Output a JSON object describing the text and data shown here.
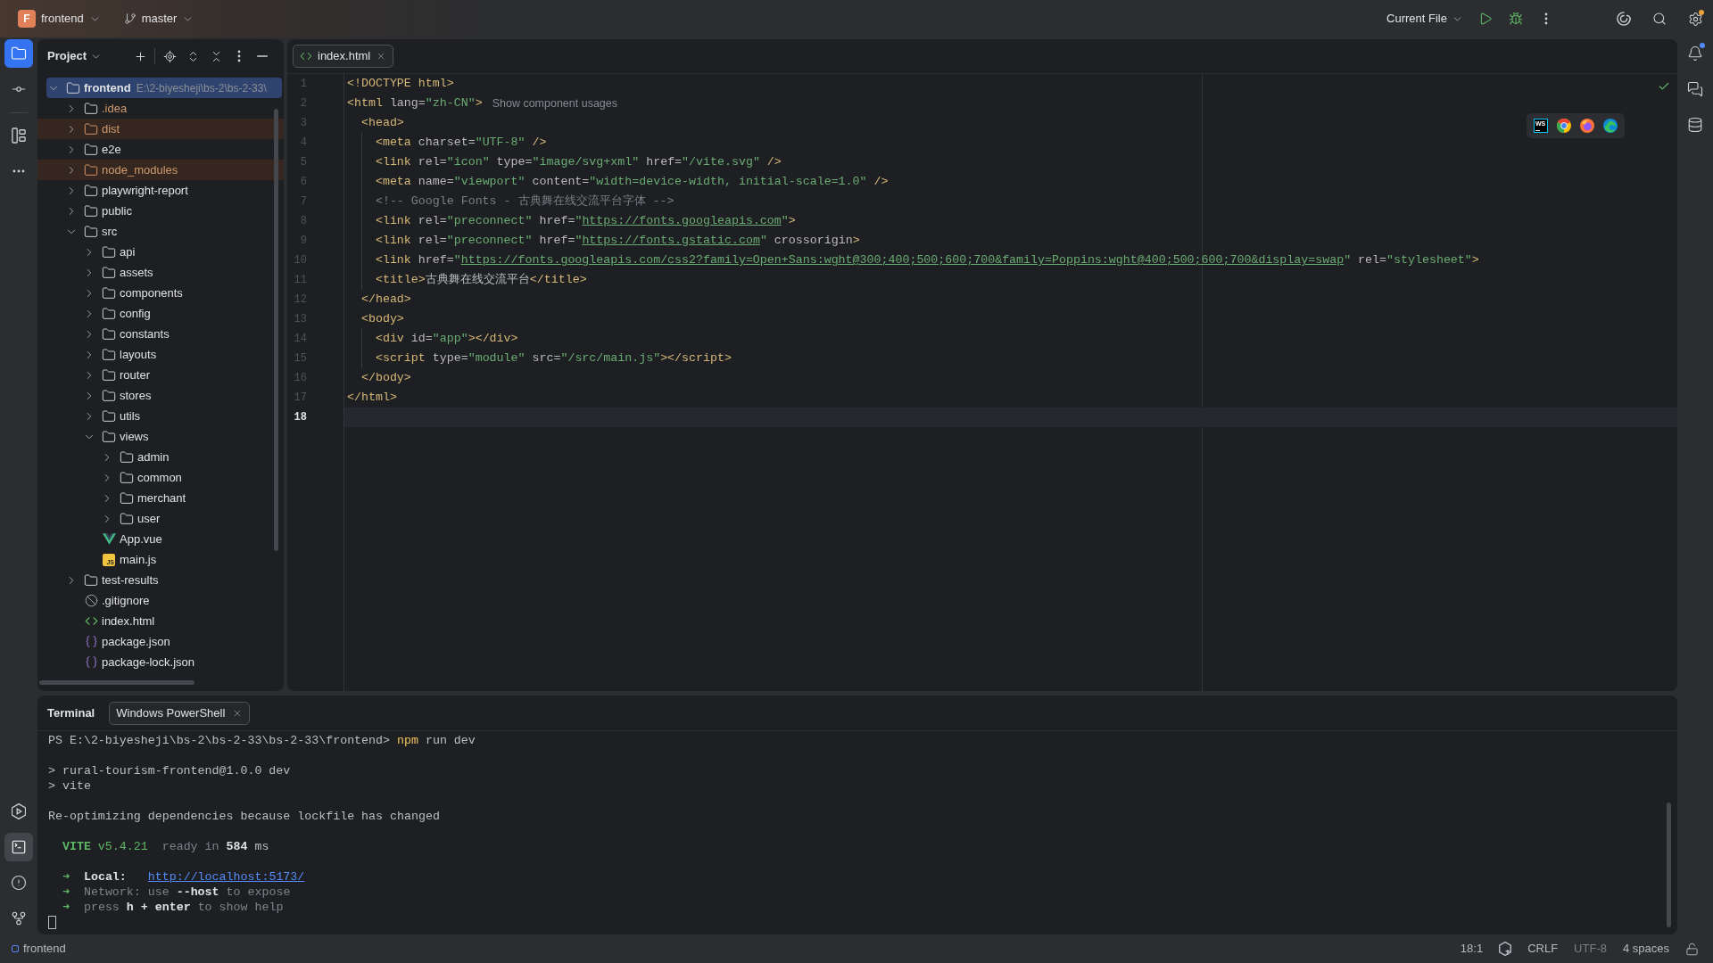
{
  "title_bar": {
    "project": {
      "initial": "F",
      "name": "frontend"
    },
    "branch": "master",
    "run_configuration": "Current File",
    "settings_badge": true
  },
  "left_toolbar": {
    "top_buttons": [
      {
        "selected": true
      },
      {
        "selected": false
      },
      {
        "selected": false
      },
      {
        "selected": false
      }
    ],
    "bottom_buttons": [
      {
        "selected": false
      },
      {
        "selected": true
      },
      {
        "selected": false
      },
      {
        "selected": false
      }
    ]
  },
  "project_panel": {
    "title": "Project",
    "tree": [
      {
        "name": "frontend",
        "path": "E:\\2-biyesheji\\bs-2\\bs-2-33\\",
        "kind": "folder",
        "expanded": true,
        "selected": true,
        "ignored": false,
        "excluded": false,
        "children": [
          {
            "name": ".idea",
            "kind": "folder",
            "expanded": false,
            "selected": false,
            "ignored": true,
            "excluded": false
          },
          {
            "name": "dist",
            "kind": "folder",
            "expanded": false,
            "selected": false,
            "ignored": true,
            "excluded": true
          },
          {
            "name": "e2e",
            "kind": "folder",
            "expanded": false,
            "selected": false,
            "ignored": false,
            "excluded": false
          },
          {
            "name": "node_modules",
            "kind": "folder",
            "expanded": false,
            "selected": false,
            "ignored": true,
            "excluded": true
          },
          {
            "name": "playwright-report",
            "kind": "folder",
            "expanded": false,
            "selected": false,
            "ignored": false,
            "excluded": false
          },
          {
            "name": "public",
            "kind": "folder",
            "expanded": false,
            "selected": false,
            "ignored": false,
            "excluded": false
          },
          {
            "name": "src",
            "kind": "folder",
            "expanded": true,
            "selected": false,
            "ignored": false,
            "excluded": false,
            "children": [
              {
                "name": "api",
                "kind": "folder",
                "expanded": false,
                "selected": false,
                "ignored": false,
                "excluded": false
              },
              {
                "name": "assets",
                "kind": "folder",
                "expanded": false,
                "selected": false,
                "ignored": false,
                "excluded": false
              },
              {
                "name": "components",
                "kind": "folder",
                "expanded": false,
                "selected": false,
                "ignored": false,
                "excluded": false
              },
              {
                "name": "config",
                "kind": "folder",
                "expanded": false,
                "selected": false,
                "ignored": false,
                "excluded": false
              },
              {
                "name": "constants",
                "kind": "folder",
                "expanded": false,
                "selected": false,
                "ignored": false,
                "excluded": false
              },
              {
                "name": "layouts",
                "kind": "folder",
                "expanded": false,
                "selected": false,
                "ignored": false,
                "excluded": false
              },
              {
                "name": "router",
                "kind": "folder",
                "expanded": false,
                "selected": false,
                "ignored": false,
                "excluded": false
              },
              {
                "name": "stores",
                "kind": "folder",
                "expanded": false,
                "selected": false,
                "ignored": false,
                "excluded": false
              },
              {
                "name": "utils",
                "kind": "folder",
                "expanded": false,
                "selected": false,
                "ignored": false,
                "excluded": false
              },
              {
                "name": "views",
                "kind": "folder",
                "expanded": true,
                "selected": false,
                "ignored": false,
                "excluded": false,
                "children": [
                  {
                    "name": "admin",
                    "kind": "folder",
                    "expanded": false,
                    "selected": false,
                    "ignored": false,
                    "excluded": false
                  },
                  {
                    "name": "common",
                    "kind": "folder",
                    "expanded": false,
                    "selected": false,
                    "ignored": false,
                    "excluded": false
                  },
                  {
                    "name": "merchant",
                    "kind": "folder",
                    "expanded": false,
                    "selected": false,
                    "ignored": false,
                    "excluded": false
                  },
                  {
                    "name": "user",
                    "kind": "folder",
                    "expanded": false,
                    "selected": false,
                    "ignored": false,
                    "excluded": false
                  }
                ]
              },
              {
                "name": "App.vue",
                "kind": "vue",
                "selected": false,
                "ignored": false,
                "excluded": false
              },
              {
                "name": "main.js",
                "kind": "js",
                "icon_text": "JS",
                "selected": false,
                "ignored": false,
                "excluded": false
              }
            ]
          },
          {
            "name": "test-results",
            "kind": "folder",
            "expanded": false,
            "selected": false,
            "ignored": false,
            "excluded": false
          },
          {
            "name": ".gitignore",
            "kind": "gitignore",
            "selected": false,
            "ignored": false,
            "excluded": false
          },
          {
            "name": "index.html",
            "kind": "html",
            "selected": false,
            "ignored": false,
            "excluded": false
          },
          {
            "name": "package.json",
            "kind": "json",
            "selected": false,
            "ignored": false,
            "excluded": false
          },
          {
            "name": "package-lock.json",
            "kind": "json",
            "selected": false,
            "ignored": false,
            "excluded": false
          }
        ]
      }
    ]
  },
  "editor": {
    "tabs": [
      {
        "name": "index.html",
        "selected": true
      }
    ],
    "lines": [
      {
        "number": "1",
        "current": false,
        "tokens": [
          {
            "text": "<!DOCTYPE html>",
            "kind": "tag"
          }
        ]
      },
      {
        "number": "2",
        "current": false,
        "tokens": [
          {
            "text": "<html",
            "kind": "tag"
          },
          {
            "text": " lang=",
            "kind": "attr"
          },
          {
            "text": "\"zh-CN\"",
            "kind": "value"
          },
          {
            "text": ">",
            "kind": "tag"
          }
        ],
        "hint": "Show component usages"
      },
      {
        "number": "3",
        "current": false,
        "tokens": [
          {
            "text": "  <head>",
            "kind": "tag"
          }
        ]
      },
      {
        "number": "4",
        "current": false,
        "tokens": [
          {
            "text": "    <meta",
            "kind": "tag"
          },
          {
            "text": " charset=",
            "kind": "attr"
          },
          {
            "text": "\"UTF-8\"",
            "kind": "value"
          },
          {
            "text": " />",
            "kind": "tag"
          }
        ]
      },
      {
        "number": "5",
        "current": false,
        "tokens": [
          {
            "text": "    <link",
            "kind": "tag"
          },
          {
            "text": " rel=",
            "kind": "attr"
          },
          {
            "text": "\"icon\"",
            "kind": "value"
          },
          {
            "text": " type=",
            "kind": "attr"
          },
          {
            "text": "\"image/svg+xml\"",
            "kind": "value"
          },
          {
            "text": " href=",
            "kind": "attr"
          },
          {
            "text": "\"/vite.svg\"",
            "kind": "value"
          },
          {
            "text": " />",
            "kind": "tag"
          }
        ]
      },
      {
        "number": "6",
        "current": false,
        "tokens": [
          {
            "text": "    <meta",
            "kind": "tag"
          },
          {
            "text": " name=",
            "kind": "attr"
          },
          {
            "text": "\"viewport\"",
            "kind": "value"
          },
          {
            "text": " content=",
            "kind": "attr"
          },
          {
            "text": "\"width=device-width, initial-scale=1.0\"",
            "kind": "value"
          },
          {
            "text": " />",
            "kind": "tag"
          }
        ]
      },
      {
        "number": "7",
        "current": false,
        "tokens": [
          {
            "text": "    <!-- Google Fonts - 古典舞在线交流平台字体 -->",
            "kind": "comment"
          }
        ]
      },
      {
        "number": "8",
        "current": false,
        "tokens": [
          {
            "text": "    <link",
            "kind": "tag"
          },
          {
            "text": " rel=",
            "kind": "attr"
          },
          {
            "text": "\"preconnect\"",
            "kind": "value"
          },
          {
            "text": " href=",
            "kind": "attr"
          },
          {
            "text": "\"",
            "kind": "value"
          },
          {
            "text": "https://fonts.googleapis.com",
            "kind": "url"
          },
          {
            "text": "\"",
            "kind": "value"
          },
          {
            "text": ">",
            "kind": "tag"
          }
        ]
      },
      {
        "number": "9",
        "current": false,
        "tokens": [
          {
            "text": "    <link",
            "kind": "tag"
          },
          {
            "text": " rel=",
            "kind": "attr"
          },
          {
            "text": "\"preconnect\"",
            "kind": "value"
          },
          {
            "text": " href=",
            "kind": "attr"
          },
          {
            "text": "\"",
            "kind": "value"
          },
          {
            "text": "https://fonts.gstatic.com",
            "kind": "url"
          },
          {
            "text": "\"",
            "kind": "value"
          },
          {
            "text": " crossorigin",
            "kind": "attr"
          },
          {
            "text": ">",
            "kind": "tag"
          }
        ]
      },
      {
        "number": "10",
        "current": false,
        "tokens": [
          {
            "text": "    <link",
            "kind": "tag"
          },
          {
            "text": " href=",
            "kind": "attr"
          },
          {
            "text": "\"",
            "kind": "value"
          },
          {
            "text": "https://fonts.googleapis.com/css2?family=Open+Sans:wght@300;400;500;600;700&family=Poppins:wght@400;500;600;700&display=swap",
            "kind": "url"
          },
          {
            "text": "\"",
            "kind": "value"
          },
          {
            "text": " rel=",
            "kind": "attr"
          },
          {
            "text": "\"stylesheet\"",
            "kind": "value"
          },
          {
            "text": ">",
            "kind": "tag"
          }
        ]
      },
      {
        "number": "11",
        "current": false,
        "tokens": [
          {
            "text": "    <title>",
            "kind": "tag"
          },
          {
            "text": "古典舞在线交流平台",
            "kind": "text"
          },
          {
            "text": "</title>",
            "kind": "tag"
          }
        ]
      },
      {
        "number": "12",
        "current": false,
        "tokens": [
          {
            "text": "  </head>",
            "kind": "tag"
          }
        ]
      },
      {
        "number": "13",
        "current": false,
        "tokens": [
          {
            "text": "  <body>",
            "kind": "tag"
          }
        ]
      },
      {
        "number": "14",
        "current": false,
        "tokens": [
          {
            "text": "    <div",
            "kind": "tag"
          },
          {
            "text": " id=",
            "kind": "attr"
          },
          {
            "text": "\"app\"",
            "kind": "value"
          },
          {
            "text": "></div>",
            "kind": "tag"
          }
        ]
      },
      {
        "number": "15",
        "current": false,
        "tokens": [
          {
            "text": "    <script",
            "kind": "tag"
          },
          {
            "text": " type=",
            "kind": "attr"
          },
          {
            "text": "\"module\"",
            "kind": "value"
          },
          {
            "text": " src=",
            "kind": "attr"
          },
          {
            "text": "\"/src/main.js\"",
            "kind": "value"
          },
          {
            "text": "></script>",
            "kind": "tag"
          }
        ]
      },
      {
        "number": "16",
        "current": false,
        "tokens": [
          {
            "text": "  </body>",
            "kind": "tag"
          }
        ]
      },
      {
        "number": "17",
        "current": false,
        "tokens": [
          {
            "text": "</html>",
            "kind": "tag"
          }
        ]
      },
      {
        "number": "18",
        "current": true
      }
    ],
    "browser_popup": {
      "ide_logo": "WS"
    }
  },
  "right_toolbar": [
    {
      "badge": true
    },
    {
      "badge": false
    },
    {
      "badge": false
    }
  ],
  "terminal": {
    "title": "Terminal",
    "tabs": [
      {
        "name": "Windows PowerShell",
        "selected": true
      }
    ],
    "blocks": [
      {
        "lines": [
          {
            "tokens": [
              {
                "text": "PS E:\\2-biyesheji\\bs-2\\bs-2-33\\bs-2-33\\frontend> ",
                "kind": "plain"
              },
              {
                "text": "npm",
                "kind": "command"
              },
              {
                "text": " run dev",
                "kind": "plain"
              }
            ]
          }
        ]
      },
      {
        "lines": [
          {
            "tokens": [
              {
                "text": "> rural-tourism-frontend@1.0.0 dev",
                "kind": "plain"
              }
            ]
          },
          {
            "tokens": [
              {
                "text": "> vite",
                "kind": "plain"
              }
            ]
          }
        ]
      },
      {
        "lines": [
          {
            "tokens": [
              {
                "text": "Re-optimizing dependencies because lockfile has changed",
                "kind": "plain"
              }
            ]
          }
        ]
      },
      {
        "lines": [
          {
            "tokens": [
              {
                "text": "  VITE",
                "kind": "accent-bold"
              },
              {
                "text": " v5.4.21",
                "kind": "accent"
              },
              {
                "text": "  ready in ",
                "kind": "dim"
              },
              {
                "text": "584",
                "kind": "bold"
              },
              {
                "text": " ms",
                "kind": "plain"
              }
            ]
          }
        ]
      },
      {
        "lines": [
          {
            "tokens": [
              {
                "text": "  ➜  ",
                "kind": "accent"
              },
              {
                "text": "Local:   ",
                "kind": "bold"
              },
              {
                "text": "http://localhost:5173/",
                "kind": "link"
              }
            ]
          },
          {
            "tokens": [
              {
                "text": "  ➜  ",
                "kind": "accent"
              },
              {
                "text": "Network: use ",
                "kind": "dim"
              },
              {
                "text": "--host",
                "kind": "bold"
              },
              {
                "text": " to expose",
                "kind": "dim"
              }
            ]
          },
          {
            "tokens": [
              {
                "text": "  ➜  ",
                "kind": "accent"
              },
              {
                "text": "press ",
                "kind": "dim"
              },
              {
                "text": "h + enter",
                "kind": "bold"
              },
              {
                "text": " to show help",
                "kind": "dim"
              }
            ]
          }
        ]
      }
    ]
  },
  "status_bar": {
    "project": "frontend",
    "items": [
      {
        "text": "18:1",
        "dimmed": false
      },
      {
        "text": "CRLF",
        "dimmed": false
      },
      {
        "text": "UTF-8",
        "dimmed": true
      },
      {
        "text": "4 spaces",
        "dimmed": false
      }
    ]
  }
}
